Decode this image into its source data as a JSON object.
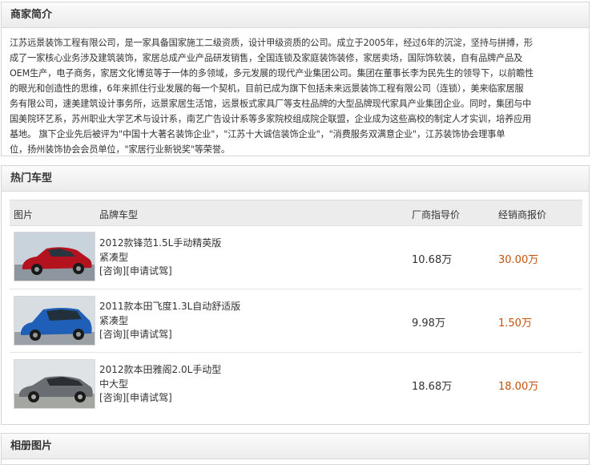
{
  "intro": {
    "title": "商家简介",
    "lines": [
      "江苏远景装饰工程有限公司，是一家具备国家施工二级资质，设计甲级资质的公司。成立于2005年，经过6年的沉淀，坚持与拼搏，形",
      "成了一家核心业务涉及建筑装饰，家居总成产业产品研发销售，全国连锁及家庭装饰装修，家居卖场，国际饰软装，自有品牌产品及",
      "OEM生产，电子商务，家居文化博览等于一体的多领域，多元发展的现代产业集团公司。集团在董事长李为民先生的领导下，以前瞻性",
      "的眼光和创造性的思维，6年来抓住行业发展的每一个契机，目前已成为旗下包括未来远景装饰工程有限公司（连锁），美来临家居服",
      "务有限公司，速美建筑设计事务所，远景家居生活馆，远景板式家具厂等支柱品牌的大型品牌现代家具产业集团企业。同时，集团与中",
      "国美院环艺系，苏州职业大学艺术与设计系，南艺广告设计系等多家院校组成院企联盟，企业成为这些高校的制定人才实训，培养应用",
      "基地。        旗下企业先后被评为\"中国十大著名装饰企业\"，\"江苏十大诚信装饰企业\"，\"消费服务双满意企业\"，江苏装饰协会理事单",
      "位，扬州装饰协会会员单位，\"家居行业新锐奖\"等荣誉。"
    ]
  },
  "cars": {
    "title": "热门车型",
    "headers": {
      "image": "图片",
      "model": "品牌车型",
      "msrp": "厂商指导价",
      "dealer": "经销商报价"
    },
    "rows": [
      {
        "name": "2012款锋范1.5L手动精英版",
        "type": "紧凑型",
        "consult": "[咨询]",
        "test_drive": "[申请试驾]",
        "msrp": "10.68万",
        "dealer": "30.00万",
        "car_color": "#b3121f"
      },
      {
        "name": "2011款本田飞度1.3L自动舒适版",
        "type": "紧凑型",
        "consult": "[咨询]",
        "test_drive": "[申请试驾]",
        "msrp": "9.98万",
        "dealer": "1.50万",
        "car_color": "#1f5fb8"
      },
      {
        "name": "2012款本田雅阁2.0L手动型",
        "type": "中大型",
        "consult": "[咨询]",
        "test_drive": "[申请试驾]",
        "msrp": "18.68万",
        "dealer": "18.00万",
        "car_color": "#6a6e72"
      }
    ]
  },
  "album": {
    "title": "相册图片"
  }
}
